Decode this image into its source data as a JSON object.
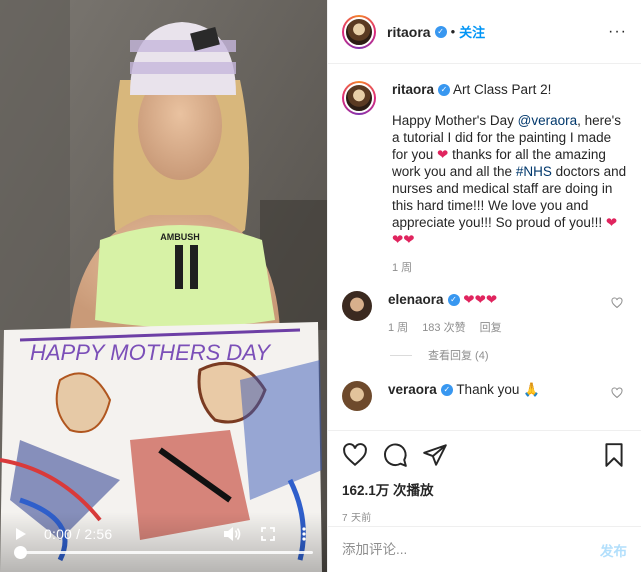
{
  "video": {
    "current_time": "0:00",
    "separator": "/",
    "duration": "2:56",
    "progress": 0.0,
    "controls": [
      "play-icon",
      "volume-icon",
      "fullscreen-icon",
      "more-vertical-icon"
    ]
  },
  "header": {
    "username": "ritaora",
    "dot": "•",
    "follow_label": "关注",
    "more_label": "···"
  },
  "caption": {
    "username": "ritaora",
    "title": "Art Class Part 2!",
    "text_part1": "Happy Mother's Day ",
    "mention": "@veraora",
    "text_part2": ", here's a tutorial I did for the painting I made for you ",
    "text_part3": " thanks for all the amazing work you and all the ",
    "hashtag": "#NHS",
    "text_part4": " doctors and nurses and medical staff are doing in this hard time!!! We love you and appreciate you!!! So proud of you!!! ",
    "time": "1 周"
  },
  "comments": [
    {
      "username": "elenaora",
      "text": "",
      "hearts": "❤❤❤",
      "time": "1 周",
      "likes": "183 次赞",
      "reply": "回复"
    },
    {
      "username": "veraora",
      "text": "Thank you 🙏"
    }
  ],
  "view_replies": "查看回复 (4)",
  "stats": {
    "views": "162.1万 次播放",
    "age": "7 天前"
  },
  "add_comment": {
    "placeholder": "添加评论...",
    "post_label": "发布"
  },
  "colors": {
    "accent_blue": "#0095f6",
    "heart_red": "#e0245e",
    "verified_blue": "#3897f0",
    "muted_gray": "#8e8e8e"
  }
}
